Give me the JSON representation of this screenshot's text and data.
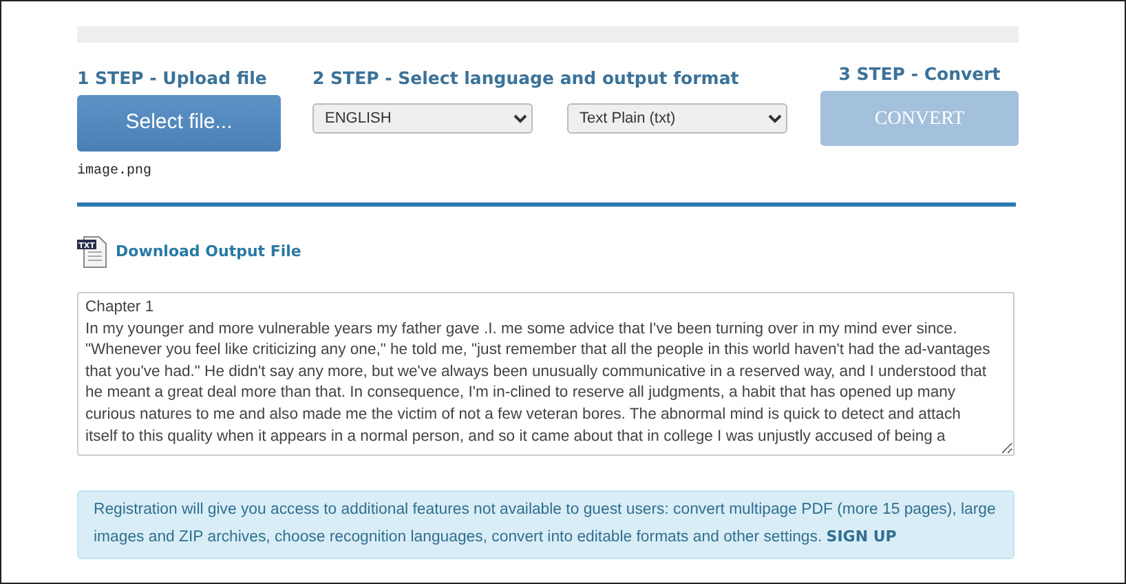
{
  "steps": [
    {
      "heading": "1 STEP - Upload file",
      "button": "Select file...",
      "filename": "image.png"
    },
    {
      "heading": "2 STEP - Select language and output format",
      "language": "ENGLISH",
      "format": "Text Plain (txt)"
    },
    {
      "heading": "3 STEP - Convert",
      "button": "CONVERT",
      "disabled": true
    }
  ],
  "download": {
    "label": "Download Output File",
    "icon_text": "TXT"
  },
  "output_text": [
    "Chapter 1",
    "In my younger and more vulnerable years my father gave .I. me some advice that I've been turning over in my mind ever since.",
    "\"Whenever you feel like criticizing any one,\" he told me, \"just remember that all the people in this world haven't had the ad-vantages",
    "that you've had.\" He didn't say any more, but we've always been unusually communicative in a reserved way, and I understood that",
    "he meant a great deal more than that. In consequence, I'm in-clined to reserve all judgments, a habit that has opened up many",
    "curious natures to me and also made me the victim of not a few veteran bores. The abnormal mind is quick to detect and attach",
    "itself to this quality when it appears in a normal person, and so it came about that in college I was unjustly accused of being a"
  ],
  "notice": {
    "text": "Registration will give you access to additional features not available to guest users: convert multipage PDF (more 15 pages), large images and ZIP archives, choose recognition languages, convert into editable formats and other settings.",
    "link": "SIGN UP"
  }
}
